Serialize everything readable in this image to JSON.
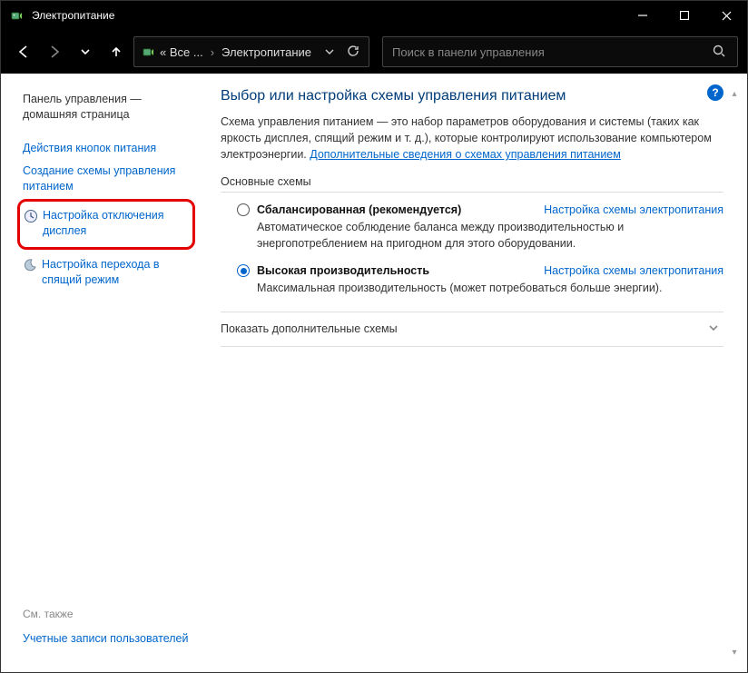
{
  "titlebar": {
    "title": "Электропитание"
  },
  "addressbar": {
    "all_prefix": "« Все ...",
    "current": "Электропитание"
  },
  "search": {
    "placeholder": "Поиск в панели управления"
  },
  "sidebar": {
    "home": "Панель управления — домашняя страница",
    "links": {
      "power_buttons": "Действия кнопок питания",
      "create_plan": "Создание схемы управления питанием",
      "display_off": "Настройка отключения дисплея",
      "sleep": "Настройка перехода в спящий режим"
    },
    "see_also_label": "См. также",
    "see_also_link": "Учетные записи пользователей"
  },
  "main": {
    "heading": "Выбор или настройка схемы управления питанием",
    "description_pre": "Схема управления питанием — это набор параметров оборудования и системы (таких как яркость дисплея, спящий режим и т. д.), которые контролируют использование компьютером электроэнергии. ",
    "description_link": "Дополнительные сведения о схемах управления питанием",
    "basic_label": "Основные схемы",
    "plans": [
      {
        "name": "Сбалансированная (рекомендуется)",
        "desc": "Автоматическое соблюдение баланса между производительностью и энергопотреблением на пригодном для этого оборудовании.",
        "link": "Настройка схемы электропитания",
        "checked": false
      },
      {
        "name": "Высокая производительность",
        "desc": "Максимальная производительность (может потребоваться больше энергии).",
        "link": "Настройка схемы электропитания",
        "checked": true
      }
    ],
    "show_more": "Показать дополнительные схемы"
  }
}
